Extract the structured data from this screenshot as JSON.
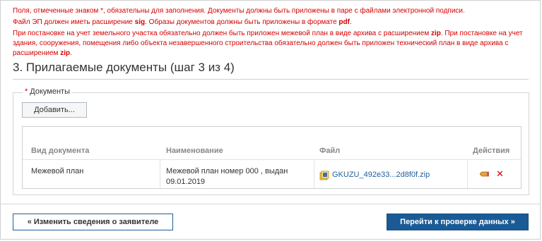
{
  "notice": {
    "line1": "Поля, отмеченные знаком *, обязательны для заполнения. Документы должны быть приложены в паре с файлами электронной подписи.",
    "line2_pre": "Файл ЭП должен иметь расширение ",
    "line2_b1": "sig",
    "line2_mid": ". Образы документов должны быть приложены в формате ",
    "line2_b2": "pdf",
    "line2_end": ".",
    "line3_pre": "При постановке на учет земельного участка обязательно должен быть приложен межевой план в виде архива с расширением ",
    "line3_b1": "zip",
    "line3_mid": ". При постановке на учет здания, сооружения, помещения либо объекта незавершенного строительства обязательно должен быть приложен технический план в виде архива с расширением ",
    "line3_b2": "zip",
    "line3_end": "."
  },
  "step_title": "3. Прилагаемые документы (шаг 3 из 4)",
  "documents": {
    "legend_required": "*",
    "legend": "Документы",
    "add_button": "Добавить..."
  },
  "table": {
    "headers": {
      "doc_type": "Вид документа",
      "name": "Наименование",
      "file": "Файл",
      "actions": "Действия"
    },
    "rows": [
      {
        "doc_type": "Межевой план",
        "name_line1": "Межевой план номер 000 , выдан",
        "name_line2": "09.01.2019",
        "file": "GKUZU_492e33...2d8f0f.zip",
        "delete_glyph": "✕"
      }
    ]
  },
  "footer": {
    "back_button": "« Изменить сведения о заявителе",
    "next_button": "Перейти к проверке данных »"
  },
  "colors": {
    "notice_red": "#d40000",
    "link_blue": "#1f5e9b",
    "primary_button": "#1a5b96"
  },
  "icons": {
    "file": "zip-file-icon",
    "edit": "pencil-edit-icon",
    "delete": "delete-x-icon"
  }
}
